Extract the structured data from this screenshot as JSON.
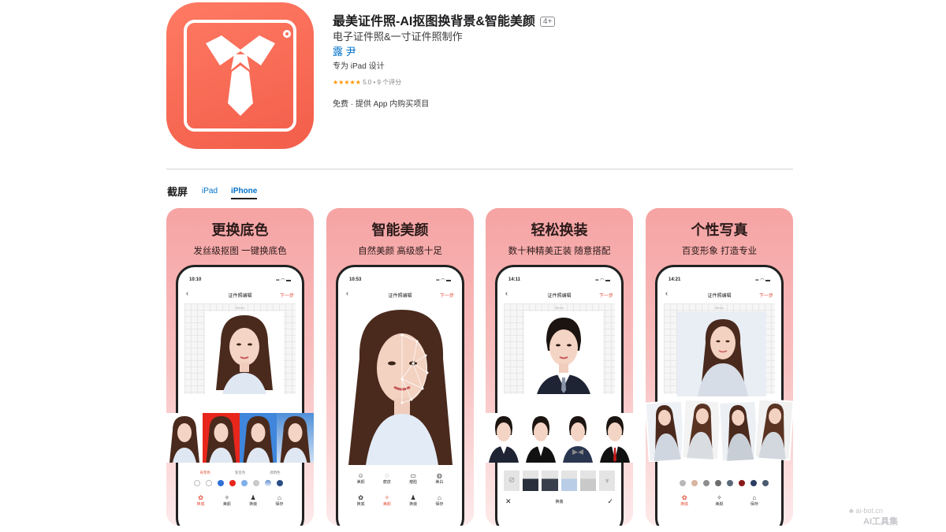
{
  "app": {
    "title": "最美证件照-AI抠图换背景&智能美颜",
    "age_rating": "4+",
    "subtitle": "电子证件照&一寸证件照制作",
    "developer": "露 尹",
    "ipad_note": "专为 iPad 设计",
    "stars": "★★★★★",
    "rating": "5.0",
    "rating_count": "• 9 个评分",
    "price": "免费 · 提供 App 内购买项目",
    "brand_color": "#f46a55"
  },
  "screenshots": {
    "heading": "截屏",
    "tabs": [
      "iPad",
      "iPhone"
    ],
    "selected_tab": "iPhone",
    "cards": [
      {
        "title": "更换底色",
        "subtitle": "发丝级抠图 一键换底色",
        "time": "10:10",
        "nav_title": "证件照编辑",
        "nav_next": "下一步",
        "size_label": "35mm",
        "thumb_labels": [
          "背景色",
          "渐变色",
          "透明色"
        ],
        "swatches": [
          "#ffffff",
          "#ffffff",
          "#2f6fd6",
          "#e8261c",
          "#7fb0ea",
          "#c9c9c9",
          "#9fb6d5",
          "#2a4e83"
        ],
        "tools": [
          {
            "icon": "✿",
            "label": "换底"
          },
          {
            "icon": "✧",
            "label": "美颜"
          },
          {
            "icon": "♟",
            "label": "换装"
          },
          {
            "icon": "⌂",
            "label": "保存"
          }
        ]
      },
      {
        "title": "智能美颜",
        "subtitle": "自然美颜 高级感十足",
        "time": "10:53",
        "nav_title": "证件照编辑",
        "nav_next": "下一步",
        "tools": [
          {
            "icon": "☺",
            "label": "美颜"
          },
          {
            "icon": "◌",
            "label": "磨皮"
          },
          {
            "icon": "▭",
            "label": "瘦脸"
          },
          {
            "icon": "◍",
            "label": "美白"
          }
        ],
        "bottom_tools": [
          {
            "icon": "✿",
            "label": "换底"
          },
          {
            "icon": "✧",
            "label": "美颜"
          },
          {
            "icon": "♟",
            "label": "换装"
          },
          {
            "icon": "⌂",
            "label": "保存"
          }
        ]
      },
      {
        "title": "轻松换装",
        "subtitle": "数十种精美正装 随意搭配",
        "time": "14:11",
        "nav_title": "证件照编辑",
        "nav_next": "下一步",
        "size_label": "35mm",
        "bottom_label": "换装",
        "cancel": "✕",
        "confirm": "✓"
      },
      {
        "title": "个性写真",
        "subtitle": "百变形象 打造专业",
        "time": "14:21",
        "nav_title": "证件照编辑",
        "nav_next": "下一步",
        "size_label": "35mm",
        "swatches": [
          "#b8b8b8",
          "#d8b5a0",
          "#8e8e8e",
          "#6d6d6d",
          "#5a6a7a",
          "#8a1a1a",
          "#2a3d63",
          "#4a5a70"
        ],
        "tools": [
          {
            "icon": "✿",
            "label": "换底"
          },
          {
            "icon": "✧",
            "label": "美颜"
          },
          {
            "icon": "⌂",
            "label": "保存"
          }
        ]
      }
    ]
  },
  "watermark": {
    "line1": "ai-bot.cn",
    "line2": "AI工具集"
  }
}
